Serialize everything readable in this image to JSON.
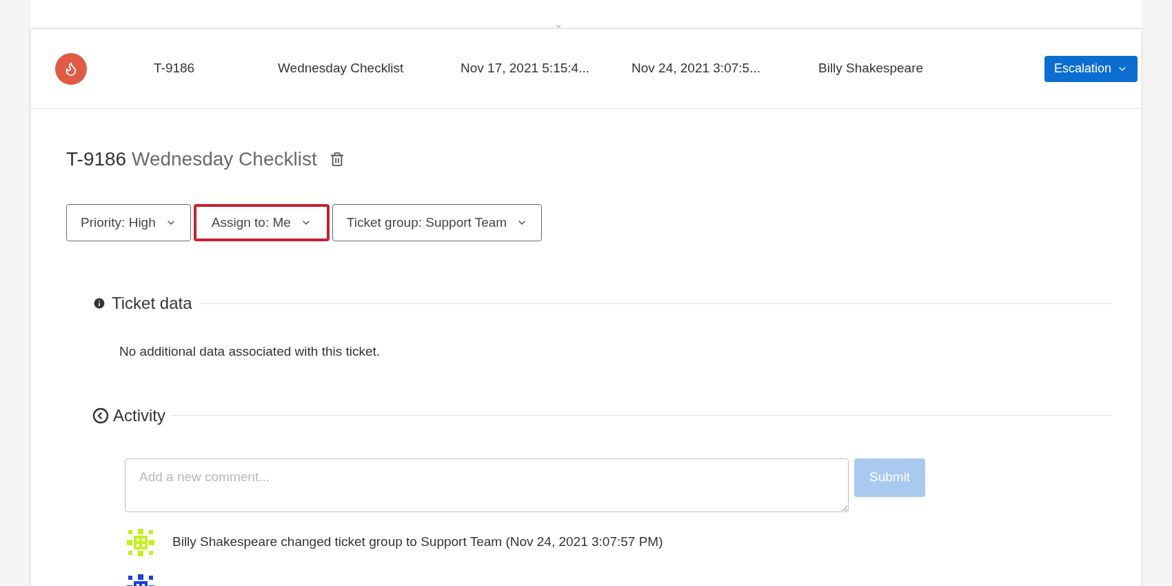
{
  "ticket_row": {
    "id": "T-9186",
    "name": "Wednesday Checklist",
    "created": "Nov 17, 2021 5:15:4...",
    "updated": "Nov 24, 2021 3:07:5...",
    "owner": "Billy Shakespeare",
    "status_button": "Escalation"
  },
  "ticket_detail": {
    "id": "T-9186",
    "name": "Wednesday Checklist",
    "filters": [
      {
        "label": "Priority: High",
        "highlighted": false
      },
      {
        "label": "Assign to: Me",
        "highlighted": true
      },
      {
        "label": "Ticket group: Support Team",
        "highlighted": false
      }
    ]
  },
  "ticket_data": {
    "heading": "Ticket data",
    "message": "No additional data associated with this ticket."
  },
  "activity": {
    "heading": "Activity",
    "comment": {
      "placeholder": "Add a new comment..."
    },
    "submit": {
      "label": "Submit",
      "disabled": true
    },
    "entries": [
      {
        "text": "Billy Shakespeare changed ticket group to Support Team (Nov 24, 2021 3:07:57 PM)",
        "color": "#c6f020"
      },
      {
        "color": "#1a3fe0"
      }
    ]
  }
}
